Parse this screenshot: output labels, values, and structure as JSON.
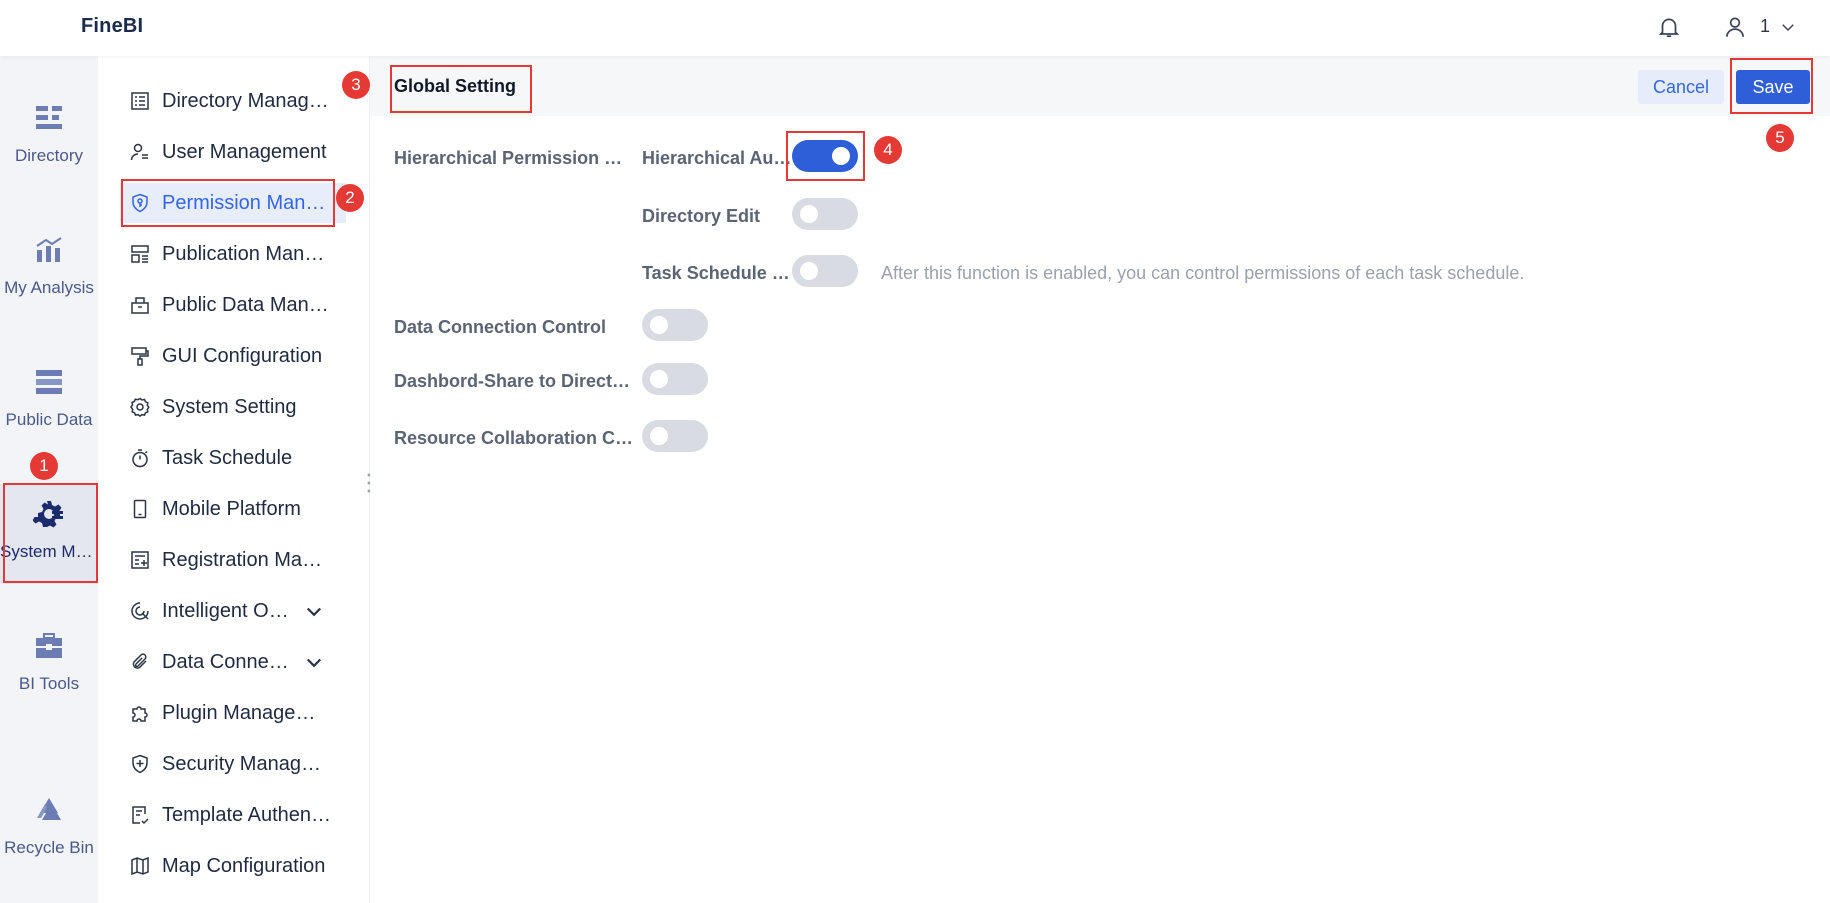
{
  "header": {
    "brand": "FineBI",
    "user_name": "1"
  },
  "rail": {
    "items": [
      {
        "label": "Directory",
        "icon": "directory-icon"
      },
      {
        "label": "My Analysis",
        "icon": "analysis-icon"
      },
      {
        "label": "Public Data",
        "icon": "public-data-icon"
      },
      {
        "label": "System Management",
        "icon": "system-gear-icon",
        "active": true
      },
      {
        "label": "BI Tools",
        "icon": "toolbox-icon"
      },
      {
        "label": "Recycle Bin",
        "icon": "recycle-icon"
      }
    ]
  },
  "menu": {
    "items": [
      {
        "label": "Directory Management",
        "icon": "list-icon"
      },
      {
        "label": "User Management",
        "icon": "user-list-icon"
      },
      {
        "label": "Permission Management",
        "icon": "shield-key-icon",
        "active": true
      },
      {
        "label": "Publication Management",
        "icon": "layout-icon"
      },
      {
        "label": "Public Data Management",
        "icon": "building-icon"
      },
      {
        "label": "GUI Configuration",
        "icon": "paint-roller-icon"
      },
      {
        "label": "System Setting",
        "icon": "gear-icon"
      },
      {
        "label": "Task Schedule",
        "icon": "stopwatch-icon"
      },
      {
        "label": "Mobile Platform",
        "icon": "phone-icon"
      },
      {
        "label": "Registration Management",
        "icon": "register-icon"
      },
      {
        "label": "Intelligent Operation",
        "icon": "intelligent-icon",
        "expandable": true
      },
      {
        "label": "Data Connection",
        "icon": "paperclip-icon",
        "expandable": true
      },
      {
        "label": "Plugin Management",
        "icon": "puzzle-icon"
      },
      {
        "label": "Security Management",
        "icon": "shield-plus-icon"
      },
      {
        "label": "Template Authentication",
        "icon": "template-icon"
      },
      {
        "label": "Map Configuration",
        "icon": "map-icon"
      }
    ]
  },
  "main": {
    "title": "Global Setting",
    "cancel_label": "Cancel",
    "save_label": "Save",
    "settings": {
      "hierarchical_permission": "Hierarchical Permission Management",
      "hierarchical_authorization": "Hierarchical Authorization",
      "hierarchical_authorization_on": true,
      "directory_edit": "Directory Edit",
      "directory_edit_on": false,
      "task_schedule": "Task Schedule Permission",
      "task_schedule_on": false,
      "task_schedule_hint": "After this function is enabled, you can control permissions of each task schedule.",
      "data_connection": "Data Connection Control",
      "data_connection_on": false,
      "dashboard_share": "Dashbord-Share to Directory",
      "dashboard_share_on": false,
      "resource_collab": "Resource Collaboration Control",
      "resource_collab_on": false
    }
  },
  "annotations": {
    "b1": "1",
    "b2": "2",
    "b3": "3",
    "b4": "4",
    "b5": "5"
  },
  "colors": {
    "accent": "#2f5fd8",
    "annotation": "#e53935",
    "rail_bg": "#f3f4f8"
  }
}
